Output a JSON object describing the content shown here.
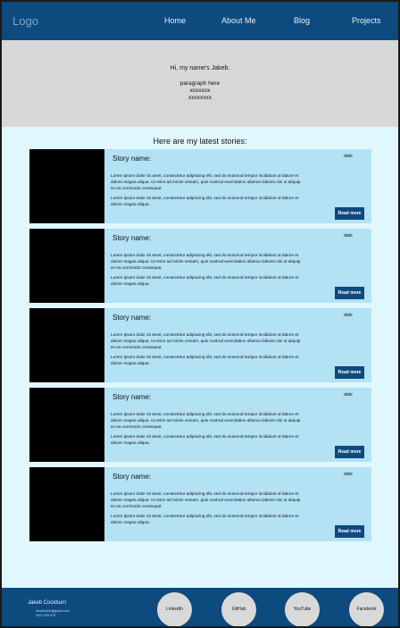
{
  "header": {
    "logo": "Logo",
    "nav": [
      "Home",
      "About Me",
      "Blog",
      "Projects"
    ]
  },
  "hero": {
    "greeting": "Hi, my name's Jakeb.",
    "paragraph": [
      "paragraph here",
      "xxxxxxx",
      "xxxxxxxx"
    ]
  },
  "stories": {
    "heading": "Here are my latest stories:",
    "items": [
      {
        "name": "Story name:",
        "date": "date",
        "para1": "Lorem ipsum dolor sit amet, consectetur adipiscing elit, sed do eiusmod tempor incididunt ut labore et dolore magna aliqua. Ut enim ad minim veniam, quis nostrud exercitation ullamco laboris nisi ut aliquip ex ea commodo consequat.",
        "para2": "Lorem ipsum dolor sit amet, consectetur adipiscing elit, sed do eiusmod tempor incididunt ut labore et dolore magna aliqua.",
        "button": "Read more"
      },
      {
        "name": "Story name:",
        "date": "date",
        "para1": "Lorem ipsum dolor sit amet, consectetur adipiscing elit, sed do eiusmod tempor incididunt ut labore et dolore magna aliqua. Ut enim ad minim veniam, quis nostrud exercitation ullamco laboris nisi ut aliquip ex ea commodo consequat.",
        "para2": "Lorem ipsum dolor sit amet, consectetur adipiscing elit, sed do eiusmod tempor incididunt ut labore et dolore magna aliqua.",
        "button": "Read more"
      },
      {
        "name": "Story name:",
        "date": "date",
        "para1": "Lorem ipsum dolor sit amet, consectetur adipiscing elit, sed do eiusmod tempor incididunt ut labore et dolore magna aliqua. Ut enim ad minim veniam, quis nostrud exercitation ullamco laboris nisi ut aliquip ex ea commodo consequat.",
        "para2": "Lorem ipsum dolor sit amet, consectetur adipiscing elit, sed do eiusmod tempor incididunt ut labore et dolore magna aliqua.",
        "button": "Read more"
      },
      {
        "name": "Story name:",
        "date": "date",
        "para1": "Lorem ipsum dolor sit amet, consectetur adipiscing elit, sed do eiusmod tempor incididunt ut labore et dolore magna aliqua. Ut enim ad minim veniam, quis nostrud exercitation ullamco laboris nisi ut aliquip ex ea commodo consequat.",
        "para2": "Lorem ipsum dolor sit amet, consectetur adipiscing elit, sed do eiusmod tempor incididunt ut labore et dolore magna aliqua.",
        "button": "Read more"
      },
      {
        "name": "Story name:",
        "date": "date",
        "para1": "Lorem ipsum dolor sit amet, consectetur adipiscing elit, sed do eiusmod tempor incididunt ut labore et dolore magna aliqua. Ut enim ad minim veniam, quis nostrud exercitation ullamco laboris nisi ut aliquip ex ea commodo consequat.",
        "para2": "Lorem ipsum dolor sit amet, consectetur adipiscing elit, sed do eiusmod tempor incididunt ut labore et dolore magna aliqua.",
        "button": "Read more"
      }
    ]
  },
  "footer": {
    "name": "Jakeb Cockburn",
    "email": "emailname@gmail.com",
    "phone": "0412 345 678",
    "social": [
      "LinkedIn",
      "GitHub",
      "YouTube",
      "Facebook"
    ]
  },
  "colors": {
    "primary": "#0d4a7e",
    "page_background": "#e0f7fd",
    "hero_background": "#d8d8d8",
    "card_background": "#b3e2f4",
    "social_circle": "#d9d9d9"
  }
}
